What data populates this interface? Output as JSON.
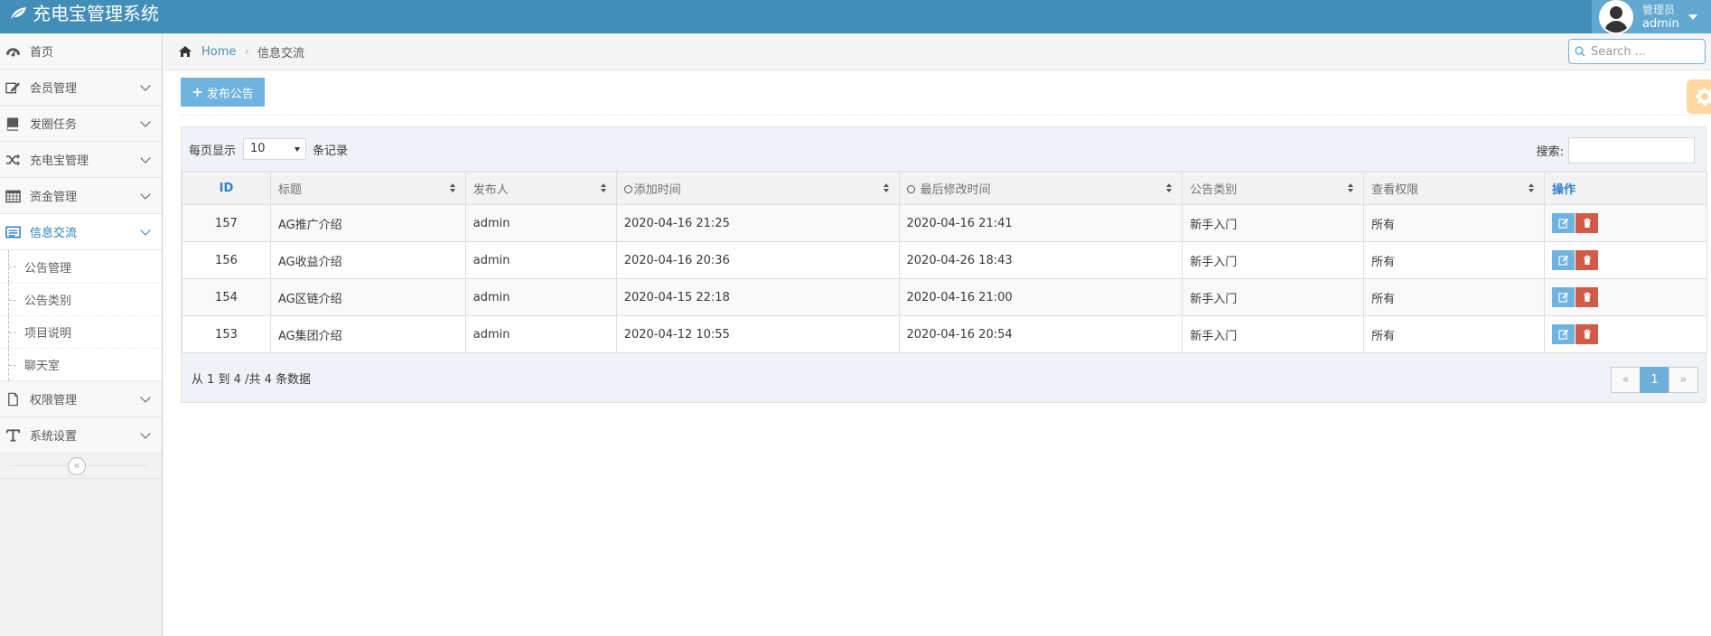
{
  "navbar": {
    "brand": "充电宝管理系统",
    "user_role": "管理员",
    "user_name": "admin"
  },
  "sidebar": {
    "items": [
      {
        "label": "首页",
        "icon": "dashboard-icon"
      },
      {
        "label": "会员管理",
        "icon": "edit-icon"
      },
      {
        "label": "发圈任务",
        "icon": "book-icon"
      },
      {
        "label": "充电宝管理",
        "icon": "shuffle-icon"
      },
      {
        "label": "资金管理",
        "icon": "calendar-icon"
      },
      {
        "label": "信息交流",
        "icon": "list-icon"
      },
      {
        "label": "权限管理",
        "icon": "file-icon"
      },
      {
        "label": "系统设置",
        "icon": "text-icon"
      }
    ],
    "submenu": [
      "公告管理",
      "公告类别",
      "项目说明",
      "聊天室"
    ],
    "collapse": "«"
  },
  "breadcrumb": {
    "home": "Home",
    "sep": "›",
    "current": "信息交流"
  },
  "search": {
    "placeholder": "Search ..."
  },
  "main": {
    "publish_label": "发布公告",
    "length_prefix": "每页显示",
    "length_value": "10",
    "length_suffix": "条记录",
    "filter_label": "搜索:",
    "columns": [
      "ID",
      "标题",
      "发布人",
      "添加时间",
      "最后修改时间",
      "公告类别",
      "查看权限",
      "操作"
    ],
    "rows": [
      {
        "id": "157",
        "title": "AG推广介绍",
        "publisher": "admin",
        "added": "2020-04-16 21:25",
        "modified": "2020-04-16 21:41",
        "category": "新手入门",
        "permission": "所有"
      },
      {
        "id": "156",
        "title": "AG收益介绍",
        "publisher": "admin",
        "added": "2020-04-16 20:36",
        "modified": "2020-04-26 18:43",
        "category": "新手入门",
        "permission": "所有"
      },
      {
        "id": "154",
        "title": "AG区链介绍",
        "publisher": "admin",
        "added": "2020-04-15 22:18",
        "modified": "2020-04-16 21:00",
        "category": "新手入门",
        "permission": "所有"
      },
      {
        "id": "153",
        "title": "AG集团介绍",
        "publisher": "admin",
        "added": "2020-04-12 10:55",
        "modified": "2020-04-16 20:54",
        "category": "新手入门",
        "permission": "所有"
      }
    ],
    "info": "从 1 到 4 /共 4 条数据",
    "pager": {
      "prev": "«",
      "current": "1",
      "next": "»"
    }
  },
  "colors": {
    "navbar": "#438eb9",
    "accent": "#6fb3e0",
    "danger": "#d15b47",
    "active_text": "#2b7dbc"
  }
}
